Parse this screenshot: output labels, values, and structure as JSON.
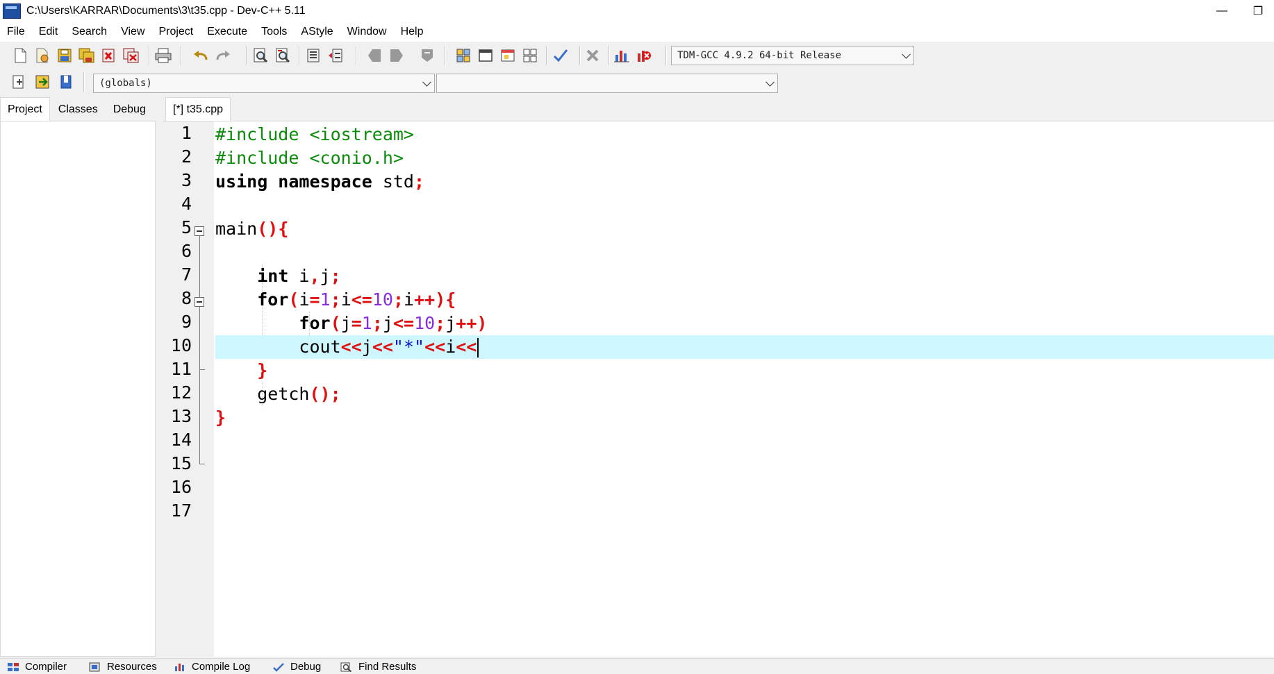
{
  "window": {
    "title": "C:\\Users\\KARRAR\\Documents\\3\\t35.cpp - Dev-C++ 5.11",
    "minimize": "—",
    "restore": "❐"
  },
  "menu": [
    "File",
    "Edit",
    "Search",
    "View",
    "Project",
    "Execute",
    "Tools",
    "AStyle",
    "Window",
    "Help"
  ],
  "toolbar": {
    "compiler_select": "TDM-GCC 4.9.2 64-bit Release",
    "scope_select": "(globals)",
    "member_select": ""
  },
  "left_panel": {
    "tabs": [
      "Project",
      "Classes",
      "Debug"
    ],
    "active_tab": "Project"
  },
  "editor": {
    "tab_label": "[*] t35.cpp",
    "line_numbers": [
      "1",
      "2",
      "3",
      "4",
      "5",
      "6",
      "7",
      "8",
      "9",
      "10",
      "11",
      "12",
      "13",
      "14",
      "15",
      "16",
      "17"
    ],
    "current_line": 10
  },
  "bottom_tabs": [
    "Compiler",
    "Resources",
    "Compile Log",
    "Debug",
    "Find Results"
  ],
  "colors": {
    "current_line": "#cdf6ff",
    "preprocessor": "#0a8c0a",
    "punctuation": "#e01010",
    "number": "#8a2be2",
    "string": "#1515d4"
  }
}
